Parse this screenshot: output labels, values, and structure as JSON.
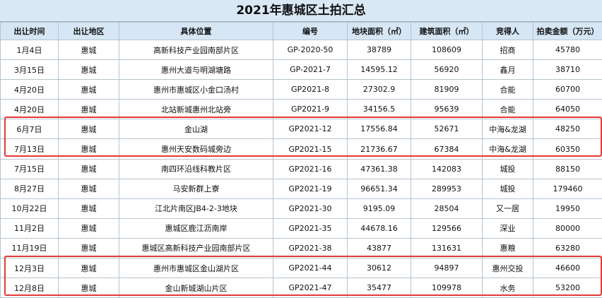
{
  "title": "2021年惠城区土拍汇总",
  "columns": [
    "出让时间",
    "出让地区",
    "具体位置",
    "编号",
    "地块面积（㎡）",
    "建筑面积（㎡）",
    "竞得人",
    "拍卖金额（万元）"
  ],
  "rows": [
    [
      "1月4日",
      "惠城",
      "高新科技产业园南部片区",
      "GP-2020-50",
      "38789",
      "108609",
      "招商",
      "45780"
    ],
    [
      "3月15日",
      "惠城",
      "惠州大道与明湖塘路",
      "GP-2021-7",
      "14595.12",
      "56920",
      "鑫月",
      "38710"
    ],
    [
      "4月20日",
      "惠城",
      "惠州市惠城区小金口汤村",
      "GP2021-8",
      "27302.9",
      "81909",
      "合能",
      "60700"
    ],
    [
      "4月20日",
      "惠城",
      "北站新城惠州北站旁",
      "GP2021-9",
      "34156.5",
      "95639",
      "合能",
      "64050"
    ],
    [
      "6月7日",
      "惠城",
      "金山湖",
      "GP2021-12",
      "17556.84",
      "52671",
      "中海&龙湖",
      "48250"
    ],
    [
      "7月13日",
      "惠城",
      "惠州天安数码城旁边",
      "GP2021-15",
      "21736.67",
      "67384",
      "中海&龙湖",
      "60350"
    ],
    [
      "7月15日",
      "惠城",
      "南四环沿线科教片区",
      "GP2021-16",
      "47361.38",
      "142083",
      "城投",
      "88150"
    ],
    [
      "8月27日",
      "惠城",
      "马安新群上寮",
      "GP2021-19",
      "96651.34",
      "289953",
      "城投",
      "179460"
    ],
    [
      "10月22日",
      "惠城",
      "江北片南区JB4-2-3地块",
      "GP2021-30",
      "9195.09",
      "28504",
      "又一居",
      "19950"
    ],
    [
      "11月2日",
      "惠城",
      "惠城区鹿江沥南岸",
      "GP2021-35",
      "44678.16",
      "129566",
      "深业",
      "80000"
    ],
    [
      "11月19日",
      "惠城",
      "惠城区高新科技产业园南部片区",
      "GP2021-38",
      "43877",
      "131631",
      "惠粮",
      "63280"
    ],
    [
      "12月3日",
      "惠城",
      "惠州市惠城区金山湖片区",
      "GP2021-44",
      "30612",
      "94897",
      "惠州交投",
      "46600"
    ],
    [
      "12月8日",
      "惠城",
      "金山新城湖山片区",
      "GP2021-47",
      "35477",
      "109978",
      "水务",
      "53200"
    ]
  ]
}
